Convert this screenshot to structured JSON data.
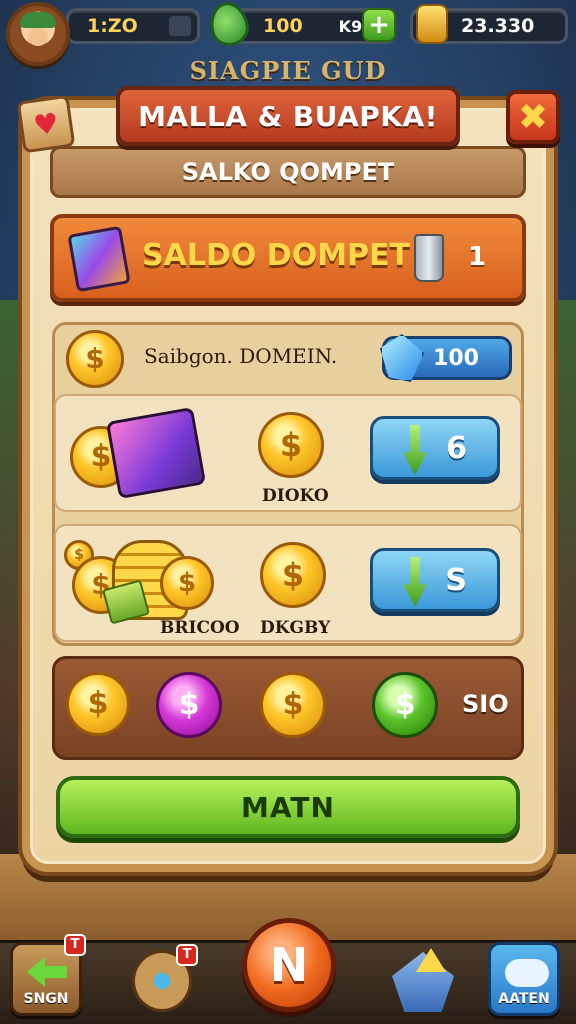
{
  "topbar": {
    "time": "1:ZO",
    "gems_value": "100",
    "gems_secondary": "K9",
    "plus_label": "+",
    "gold_value": "23.330",
    "subtitle": "SIAGPIE GUD"
  },
  "dialog": {
    "title": "MALLA & BUAPKA!",
    "close_label": "✖",
    "heart_label": "♥",
    "subtitle": "SALKO QOMPET"
  },
  "feature": {
    "label": "SALDO DOMPET",
    "count": "1"
  },
  "list": {
    "header": {
      "label": "Saibgon. DOMEIN.",
      "value": "100"
    },
    "rows": [
      {
        "label": "DIOKO",
        "button_value": "6"
      },
      {
        "left_label": "BRICOO",
        "label": "DKGBY",
        "button_value": "S"
      }
    ]
  },
  "coin_symbol": "$",
  "bottom": {
    "value": "SIO"
  },
  "main_button": {
    "label": "MATN"
  },
  "nav": {
    "back_label": "SNGN",
    "back_badge": "T",
    "bag_badge": "T",
    "center_label": "N",
    "cloud_label": "AATEN"
  },
  "colors": {
    "panel": "#ecd4a2",
    "title_banner": "#c8472a",
    "feature_row": "#e4742a",
    "main_button": "#7fcb2e",
    "action_button": "#4aa6de"
  }
}
